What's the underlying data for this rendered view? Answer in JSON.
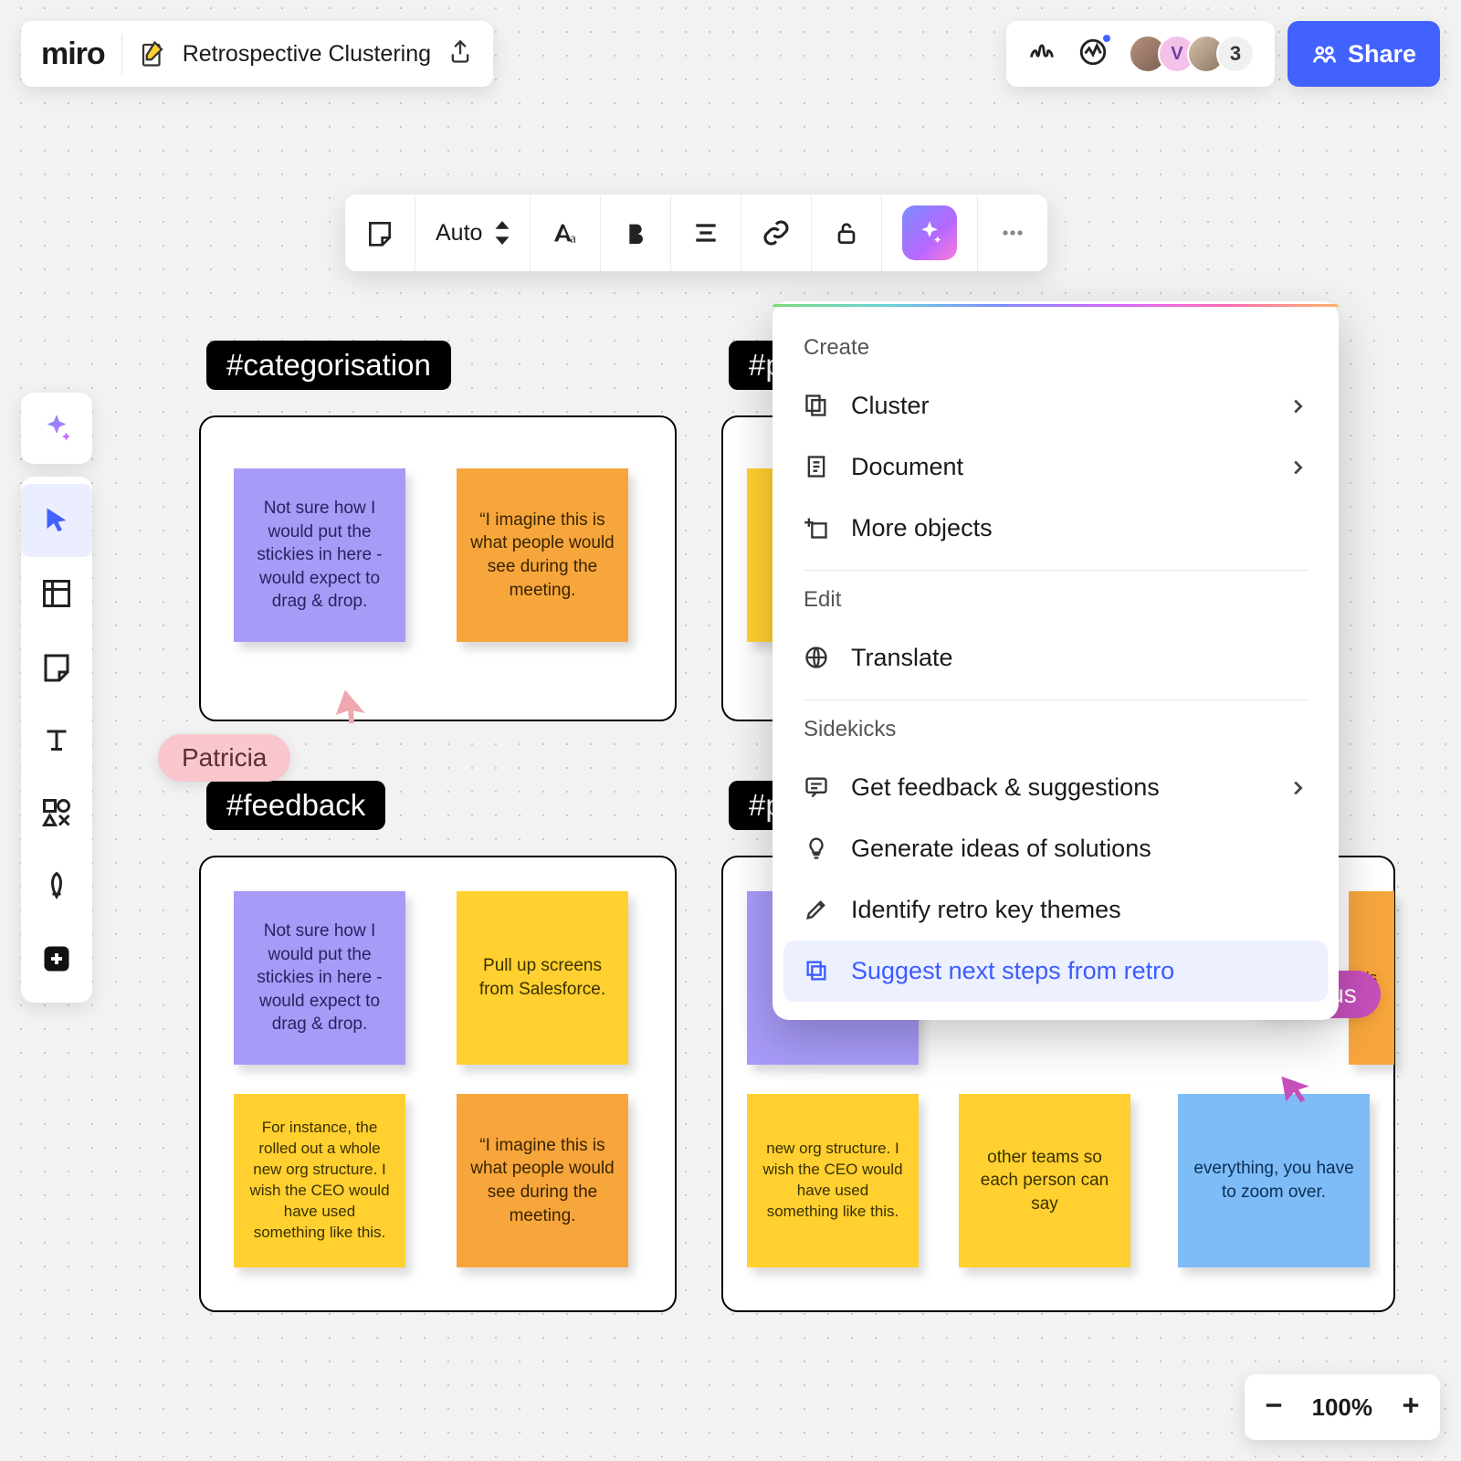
{
  "app": {
    "logo": "miro",
    "board_title": "Retrospective Clustering"
  },
  "collab": {
    "avatar_letter": "V",
    "extra_count": "3",
    "share_label": "Share"
  },
  "format_toolbar": {
    "size_mode": "Auto"
  },
  "tags": {
    "categorisation": "#categorisation",
    "p1": "#p",
    "feedback": "#feedback",
    "p2": "#p"
  },
  "stickies": {
    "drag_drop": "Not sure how I would put the stickies in here - would expect to drag & drop.",
    "imagine_meeting": "“I imagine this is what people would see during the meeting.",
    "salesforce": "Pull up screens from Salesforce.",
    "org_structure": "For instance, the rolled out a whole new org structure. I wish the CEO would have used something like this.",
    "org_structure_short": "new org structure. I wish the CEO would have used something like this.",
    "other_teams": "other teams so each person can say",
    "zoom": "everything, you have to zoom over.",
    "this": "is"
  },
  "cursors": {
    "patricia": "Patricia",
    "marcus": "Marcus"
  },
  "ai_panel": {
    "heading_create": "Create",
    "cluster": "Cluster",
    "document": "Document",
    "more_objects": "More objects",
    "heading_edit": "Edit",
    "translate": "Translate",
    "heading_sidekicks": "Sidekicks",
    "feedback": "Get feedback & suggestions",
    "ideas": "Generate ideas of solutions",
    "themes": "Identify retro key themes",
    "next_steps": "Suggest next steps from retro"
  },
  "zoom": {
    "level": "100%"
  }
}
